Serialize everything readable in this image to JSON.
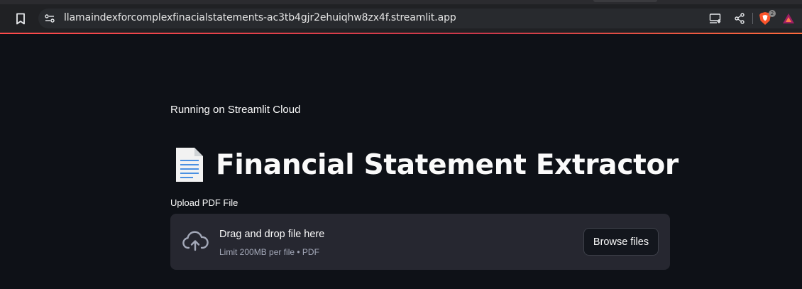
{
  "browser": {
    "url": "llamaindexforcomplexfinacialstatements-ac3tb4gjr2ehuiqhw8zx4f.streamlit.app",
    "icons": [
      "bookmark-icon",
      "site-info-icon",
      "install-app-icon",
      "share-icon",
      "brave-shields-icon",
      "brave-rewards-icon"
    ],
    "shields_count": "2",
    "accent": "#ff4b4b"
  },
  "page": {
    "running_text": "Running on Streamlit Cloud",
    "title": "Financial Statement Extractor",
    "title_icon": "document-icon",
    "background": "#0e1117"
  },
  "uploader": {
    "label": "Upload PDF File",
    "instructions": "Drag and drop file here",
    "limit": "Limit 200MB per file • PDF",
    "browse_label": "Browse files",
    "icon": "cloud-upload-icon"
  }
}
